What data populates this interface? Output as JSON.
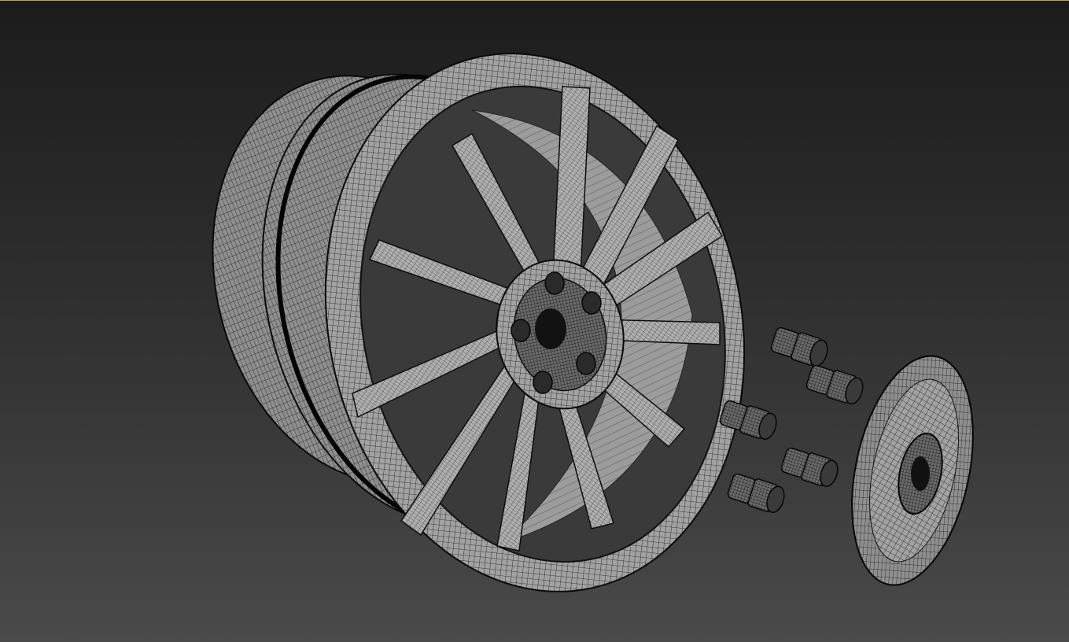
{
  "viewport": {
    "active_border_color": "#c8a53c",
    "background_top": "#1c1c1c",
    "background_bottom": "#4a4a4a"
  },
  "scene": {
    "objects": [
      {
        "name": "wheel-rim",
        "kind": "wireframe-mesh"
      },
      {
        "name": "lug-nut",
        "kind": "wireframe-mesh",
        "count": 5
      },
      {
        "name": "center-cap",
        "kind": "wireframe-mesh"
      }
    ],
    "wire_color": "#111111",
    "surface_color": "#9a9a9a"
  }
}
